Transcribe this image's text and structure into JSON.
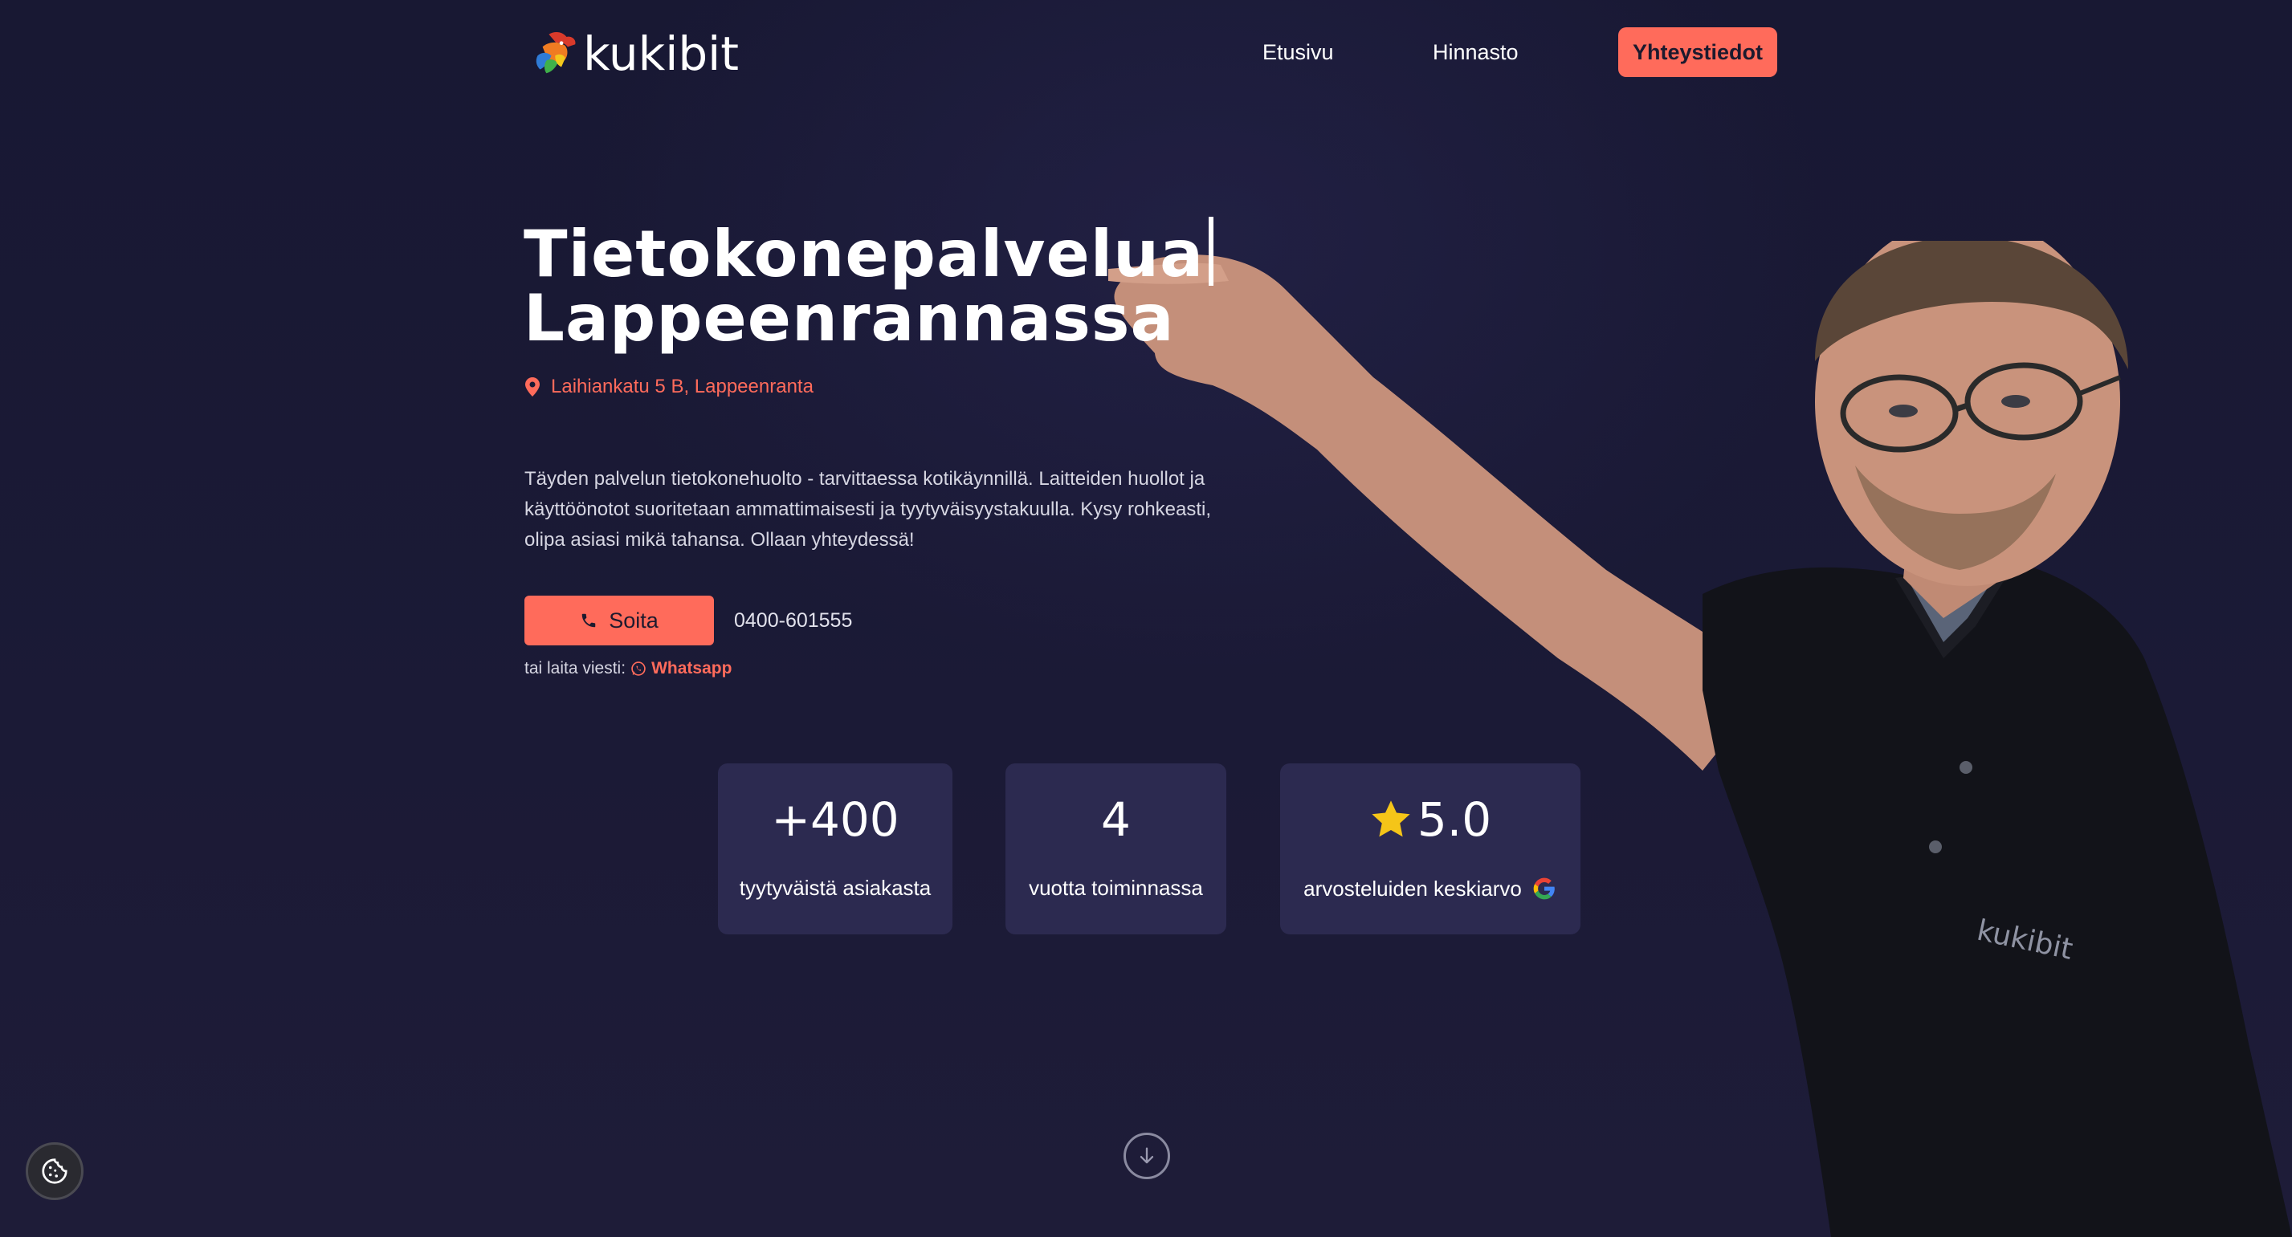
{
  "brand": {
    "name": "kukibit"
  },
  "nav": {
    "home": "Etusivu",
    "pricing": "Hinnasto",
    "contact": "Yhteystiedot"
  },
  "hero": {
    "title_line1": "Tietokonepalvelua",
    "title_line2": "Lappeenrannassa",
    "address": "Laihiankatu 5 B, Lappeenranta",
    "description": "Täyden palvelun tietokonehuolto - tarvittaessa kotikäynnillä. Laitteiden huollot ja käyttöönotot suoritetaan ammattimaisesti ja tyytyväisyystakuulla. Kysy rohkeasti, olipa asiasi mikä tahansa. Ollaan yhteydessä!",
    "call_label": "Soita",
    "phone": "0400-601555",
    "message_prefix": "tai laita viesti:",
    "whatsapp_label": "Whatsapp"
  },
  "stats": [
    {
      "value": "+400",
      "label": "tyytyväistä asiakasta"
    },
    {
      "value": "4",
      "label": "vuotta toiminnassa"
    },
    {
      "value": "5.0",
      "label": "arvosteluiden keskiarvo"
    }
  ],
  "shirt_logo": "kukibit",
  "colors": {
    "accent": "#ff6b5b",
    "background": "#1a1934",
    "card": "#2c2a50",
    "star": "#f5c518"
  },
  "icons": [
    "location-pin-icon",
    "phone-icon",
    "whatsapp-icon",
    "star-icon",
    "google-icon",
    "arrow-down-icon",
    "cookie-icon"
  ]
}
